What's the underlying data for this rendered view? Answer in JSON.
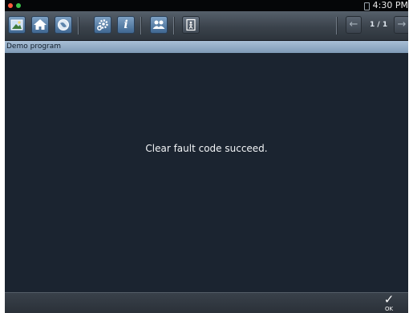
{
  "status_bar": {
    "time": "4:30 PM",
    "indicator_colors": [
      "#ff5a3c",
      "#3cc24a"
    ]
  },
  "toolbar": {
    "buttons": [
      {
        "name": "gallery-icon"
      },
      {
        "name": "home-icon"
      },
      {
        "name": "globe-icon"
      },
      {
        "name": "settings-icon"
      },
      {
        "name": "info-icon"
      },
      {
        "name": "group-icon"
      },
      {
        "name": "exit-icon"
      }
    ],
    "info_glyph": "i",
    "page_indicator": "1 / 1",
    "prev_glyph": "←",
    "next_glyph": "→"
  },
  "title_bar": {
    "title": "Demo program"
  },
  "content": {
    "message": "Clear fault code succeed."
  },
  "bottom_bar": {
    "ok_check": "✓",
    "ok_label": "OK"
  }
}
